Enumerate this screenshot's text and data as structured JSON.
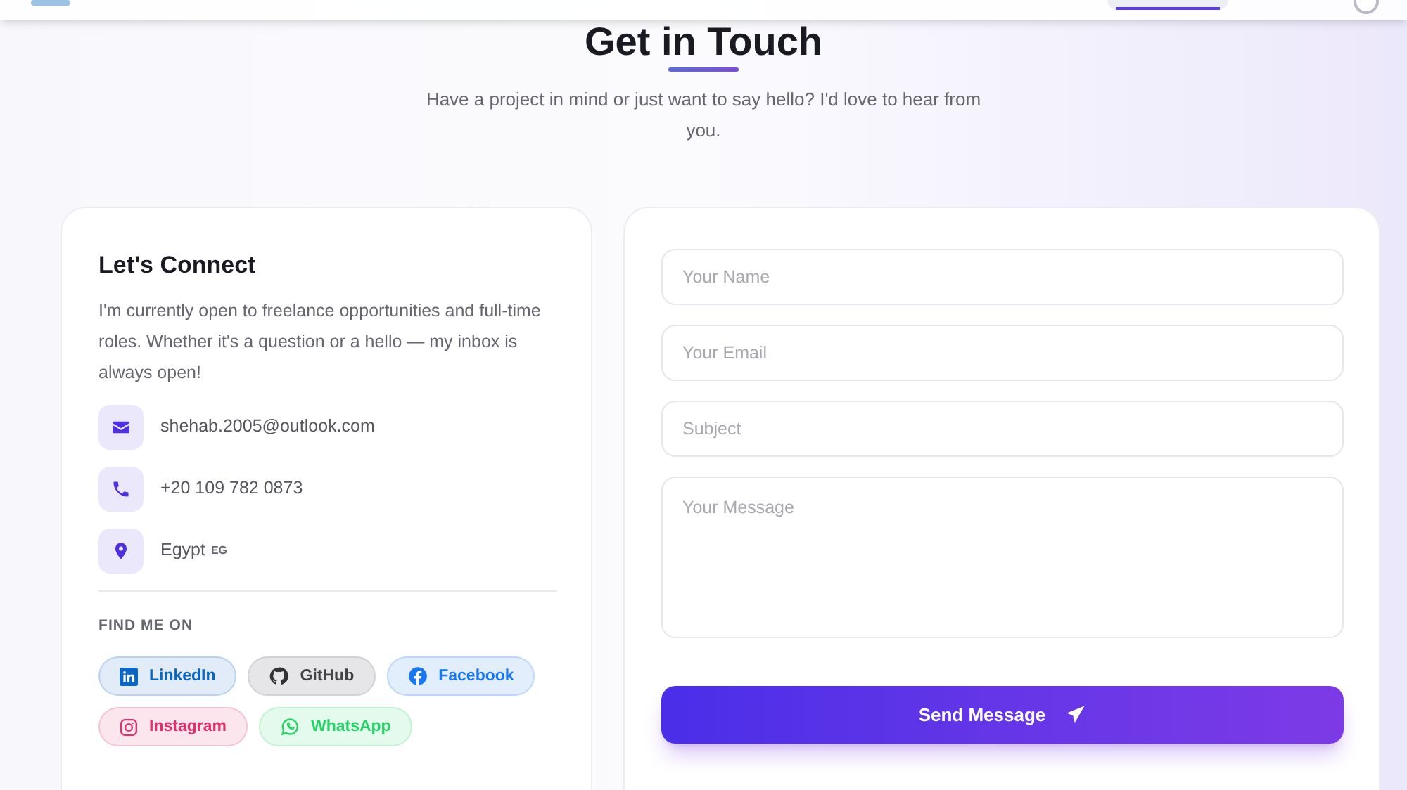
{
  "header": {
    "title": "Get in Touch",
    "subtitle": "Have a project in mind or just want to say hello? I'd love to hear from you."
  },
  "connect": {
    "title": "Let's Connect",
    "text": "I'm currently open to freelance opportunities and full-time roles. Whether it's a question or a hello — my inbox is always open!",
    "contacts": [
      {
        "kind": "email",
        "text": "shehab.2005@outlook.com"
      },
      {
        "kind": "phone",
        "text": "+20 109 782 0873"
      },
      {
        "kind": "location",
        "text": "Egypt",
        "tag": "EG"
      }
    ],
    "social_heading": "FIND ME ON",
    "socials": [
      {
        "kind": "linkedin",
        "label": "LinkedIn",
        "color": "#0a66c2"
      },
      {
        "kind": "github",
        "label": "GitHub",
        "color": "#333333"
      },
      {
        "kind": "facebook",
        "label": "Facebook",
        "color": "#1877f2"
      },
      {
        "kind": "instagram",
        "label": "Instagram",
        "color": "#e1306c"
      },
      {
        "kind": "whatsapp",
        "label": "WhatsApp",
        "color": "#25d366"
      }
    ]
  },
  "form": {
    "fields": [
      {
        "kind": "input",
        "placeholder": "Your Name"
      },
      {
        "kind": "input",
        "placeholder": "Your Email"
      },
      {
        "kind": "input",
        "placeholder": "Subject"
      },
      {
        "kind": "textarea",
        "placeholder": "Your Message"
      }
    ],
    "submit": "Send Message"
  }
}
